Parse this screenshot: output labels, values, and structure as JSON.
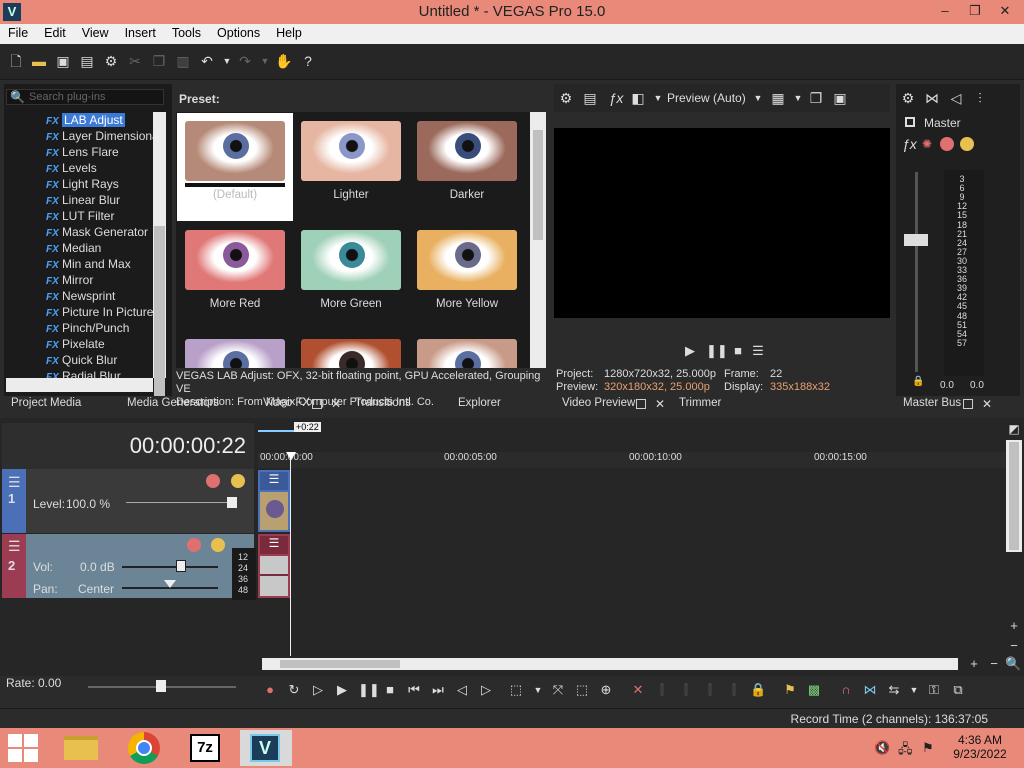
{
  "window": {
    "title": "Untitled * - VEGAS Pro 15.0",
    "minimize": "–",
    "restore": "❐",
    "close": "✕",
    "app_icon": "V"
  },
  "menu": [
    "File",
    "Edit",
    "View",
    "Insert",
    "Tools",
    "Options",
    "Help"
  ],
  "toolbar_icons": [
    "new-icon",
    "open-icon",
    "save-icon",
    "save-as-icon",
    "settings-icon",
    "cut-icon",
    "copy-icon",
    "paste-icon",
    "undo-icon",
    "redo-icon",
    "whats-this-icon"
  ],
  "plugins": {
    "search_placeholder": "Search plug-ins",
    "items": [
      "LAB Adjust",
      "Layer Dimensional",
      "Lens Flare",
      "Levels",
      "Light Rays",
      "Linear Blur",
      "LUT Filter",
      "Mask Generator",
      "Median",
      "Min and Max",
      "Mirror",
      "Newsprint",
      "Picture In Picture",
      "Pinch/Punch",
      "Pixelate",
      "Quick Blur",
      "Radial Blur"
    ],
    "fx_icon_text": "FX"
  },
  "presets": {
    "header": "Preset:",
    "items": [
      {
        "label": "(Default)",
        "color": "#b68a78",
        "pupil": "#5a6ea0"
      },
      {
        "label": "Lighter",
        "color": "#e6b6a2",
        "pupil": "#8a98c8"
      },
      {
        "label": "Darker",
        "color": "#9b6a5c",
        "pupil": "#3a4d7a"
      },
      {
        "label": "More Red",
        "color": "#e07878",
        "pupil": "#8a5a9a"
      },
      {
        "label": "More Green",
        "color": "#9fd0b8",
        "pupil": "#3a8a9a"
      },
      {
        "label": "More Yellow",
        "color": "#e8b060",
        "pupil": "#6a6a8a"
      },
      {
        "label": "",
        "color": "#b8a0c8",
        "pupil": "#5a6ea0"
      },
      {
        "label": "",
        "color": "#b05030",
        "pupil": "#3a2a2a"
      },
      {
        "label": "",
        "color": "#c89a88",
        "pupil": "#5a6ea0"
      }
    ]
  },
  "description": {
    "line1": "VEGAS LAB Adjust: OFX, 32-bit floating point, GPU Accelerated, Grouping VE",
    "line2": "Description: From Magix Computer Products Intl. Co."
  },
  "left_tabs": [
    "Project Media",
    "Media Generators",
    "Video FX",
    "Transitions",
    "Explorer"
  ],
  "preview": {
    "mode": "Preview (Auto)",
    "project_label": "Project:",
    "project_value": "1280x720x32, 25.000p",
    "preview_label": "Preview:",
    "preview_value": "320x180x32, 25.000p",
    "frame_label": "Frame:",
    "frame_value": "22",
    "display_label": "Display:",
    "display_value": "335x188x32",
    "accent": "#e8a070"
  },
  "preview_tabs": [
    "Video Preview",
    "Trimmer"
  ],
  "master": {
    "label": "Master",
    "scale": [
      "3",
      "6",
      "9",
      "12",
      "15",
      "18",
      "21",
      "24",
      "27",
      "30",
      "33",
      "36",
      "39",
      "42",
      "45",
      "48",
      "51",
      "54",
      "57"
    ],
    "left_value": "0.0",
    "right_value": "0.0",
    "tab": "Master Bus"
  },
  "timeline": {
    "timecode": "00:00:00:22",
    "marker": "+0:22",
    "ruler": [
      "00:00:00:00",
      "00:00:05:00",
      "00:00:10:00",
      "00:00:15:00"
    ],
    "track1": {
      "number": "1",
      "level_label": "Level:",
      "level_value": "100.0 %"
    },
    "track2": {
      "number": "2",
      "vol_label": "Vol:",
      "vol_value": "0.0 dB",
      "pan_label": "Pan:",
      "pan_value": "Center",
      "db_scale": [
        "12",
        "24",
        "36",
        "48"
      ]
    },
    "rate_label": "Rate:",
    "rate_value": "0.00"
  },
  "status": {
    "record_time": "Record Time (2 channels): 136:37:05"
  },
  "taskbar": {
    "time": "4:36 AM",
    "date": "9/23/2022"
  }
}
